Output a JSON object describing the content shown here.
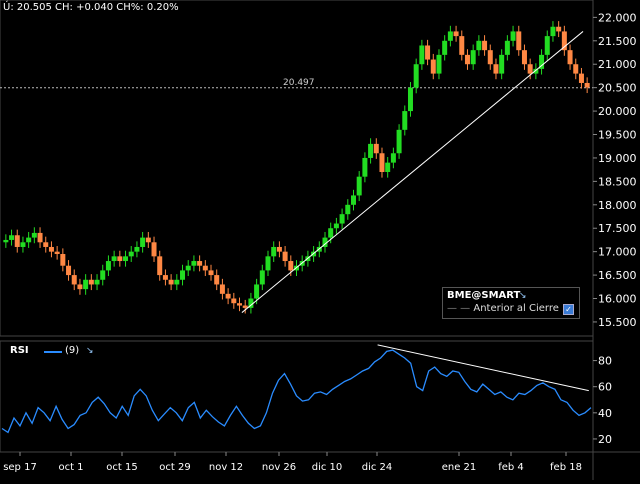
{
  "header": {
    "last": "Ú: 20.505",
    "change": "CH: +0.040",
    "change_pct": "CH%: 0.20%"
  },
  "legend": {
    "title": "BME@SMART",
    "item": "Anterior al Cierre",
    "checked": true
  },
  "rsi_panel": {
    "label": "RSI",
    "period": "(9)"
  },
  "colors": {
    "up": "#22dd22",
    "down": "#ff8844",
    "rsi": "#2a8cff",
    "trend": "#ffffff",
    "grid": "#2a2a2a"
  },
  "chart_data": [
    {
      "type": "candlestick",
      "title": "",
      "ylim": [
        15.2,
        22.2
      ],
      "y_ticks": [
        "15.500",
        "16.000",
        "16.500",
        "17.000",
        "17.500",
        "18.000",
        "18.500",
        "19.000",
        "19.500",
        "20.000",
        "20.500",
        "21.000",
        "21.500",
        "22.000"
      ],
      "x_tick_labels": [
        "sep 17",
        "oct 1",
        "oct 15",
        "oct 29",
        "nov 12",
        "nov 26",
        "dic 10",
        "dic 24",
        "ene 21",
        "feb 4",
        "feb 18"
      ],
      "reference_line": {
        "label": "20.497",
        "value": 20.497
      },
      "trendline": {
        "from": [
          0.378,
          15.7
        ],
        "to": [
          0.911,
          21.7
        ]
      },
      "closes": [
        17.25,
        17.35,
        17.1,
        17.2,
        17.3,
        17.4,
        17.2,
        17.1,
        17.0,
        16.95,
        16.7,
        16.5,
        16.3,
        16.2,
        16.4,
        16.3,
        16.4,
        16.6,
        16.8,
        16.9,
        16.8,
        16.9,
        17.0,
        17.1,
        17.3,
        17.2,
        16.9,
        16.5,
        16.4,
        16.3,
        16.4,
        16.6,
        16.7,
        16.8,
        16.7,
        16.6,
        16.5,
        16.3,
        16.1,
        16.0,
        15.9,
        15.85,
        15.8,
        16.0,
        16.3,
        16.6,
        16.9,
        17.1,
        17.0,
        16.8,
        16.6,
        16.7,
        16.8,
        16.9,
        17.0,
        17.1,
        17.3,
        17.5,
        17.6,
        17.8,
        18.0,
        18.2,
        18.6,
        19.0,
        19.3,
        19.1,
        18.7,
        18.9,
        19.1,
        19.6,
        20.0,
        20.5,
        21.0,
        21.4,
        21.1,
        20.8,
        21.2,
        21.5,
        21.7,
        21.6,
        21.2,
        21.0,
        21.3,
        21.5,
        21.3,
        21.0,
        20.8,
        21.2,
        21.5,
        21.7,
        21.3,
        21.0,
        20.8,
        20.9,
        21.2,
        21.6,
        21.8,
        21.7,
        21.3,
        21.0,
        20.8,
        20.6,
        20.505
      ],
      "series": [
        {
          "name": "",
          "values": []
        }
      ]
    },
    {
      "type": "line",
      "title": "RSI (9)",
      "ylim": [
        10,
        95
      ],
      "y_ticks": [
        "20",
        "40",
        "60",
        "80"
      ],
      "trendline": {
        "from": [
          0.59,
          92
        ],
        "to": [
          0.92,
          57
        ]
      },
      "values": [
        28,
        25,
        36,
        30,
        40,
        32,
        44,
        40,
        34,
        45,
        35,
        28,
        31,
        38,
        40,
        48,
        52,
        47,
        40,
        36,
        45,
        38,
        53,
        58,
        53,
        42,
        34,
        39,
        44,
        40,
        34,
        44,
        48,
        36,
        42,
        37,
        33,
        30,
        38,
        45,
        38,
        32,
        28,
        30,
        40,
        55,
        65,
        70,
        62,
        53,
        49,
        50,
        55,
        56,
        54,
        58,
        61,
        64,
        66,
        69,
        72,
        74,
        79,
        82,
        87,
        88,
        85,
        82,
        78,
        60,
        57,
        72,
        75,
        70,
        68,
        72,
        71,
        64,
        58,
        56,
        62,
        58,
        54,
        56,
        52,
        50,
        55,
        54,
        57,
        61,
        63,
        60,
        58,
        50,
        48,
        42,
        38,
        40,
        44
      ]
    }
  ]
}
